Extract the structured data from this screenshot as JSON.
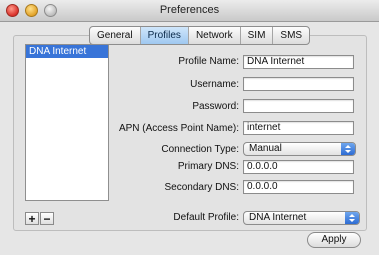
{
  "window": {
    "title": "Preferences"
  },
  "tabs": [
    {
      "label": "General"
    },
    {
      "label": "Profiles",
      "selected": true
    },
    {
      "label": "Network"
    },
    {
      "label": "SIM"
    },
    {
      "label": "SMS"
    }
  ],
  "profiles": {
    "items": [
      "DNA Internet"
    ],
    "selected_index": 0
  },
  "list_buttons": {
    "add": "+",
    "remove": "−"
  },
  "form": {
    "profile_name": {
      "label": "Profile Name:",
      "value": "DNA Internet"
    },
    "username": {
      "label": "Username:",
      "value": ""
    },
    "password": {
      "label": "Password:",
      "value": ""
    },
    "apn": {
      "label": "APN (Access Point Name):",
      "value": "internet"
    },
    "connection_type": {
      "label": "Connection Type:",
      "value": "Manual"
    },
    "primary_dns": {
      "label": "Primary DNS:",
      "value": "0.0.0.0"
    },
    "secondary_dns": {
      "label": "Secondary DNS:",
      "value": "0.0.0.0"
    }
  },
  "default_profile": {
    "label": "Default Profile:",
    "value": "DNA Internet"
  },
  "apply_label": "Apply",
  "colors": {
    "selection": "#3874d8",
    "tab_selected": "#a9d0f5",
    "popup_arrow": "#2d6cd3"
  }
}
